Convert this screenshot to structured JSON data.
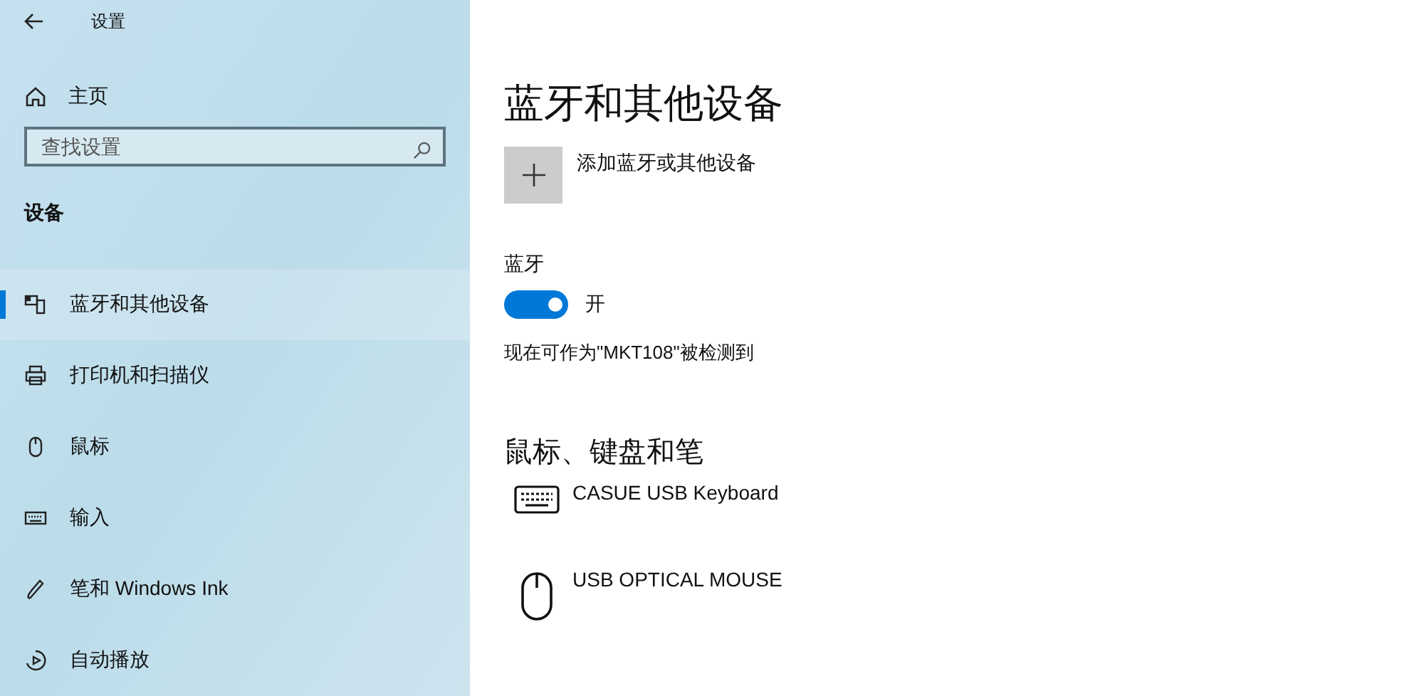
{
  "window": {
    "title": "设置"
  },
  "sidebar": {
    "home": "主页",
    "search": {
      "placeholder": "查找设置"
    },
    "section": "设备",
    "items": [
      {
        "label": "蓝牙和其他设备",
        "kind": "bluetooth",
        "selected": true
      },
      {
        "label": "打印机和扫描仪",
        "kind": "printer",
        "selected": false
      },
      {
        "label": "鼠标",
        "kind": "mouse",
        "selected": false
      },
      {
        "label": "输入",
        "kind": "keyboard",
        "selected": false
      },
      {
        "label": "笔和 Windows Ink",
        "kind": "pen",
        "selected": false
      },
      {
        "label": "自动播放",
        "kind": "autoplay",
        "selected": false
      }
    ]
  },
  "main": {
    "title": "蓝牙和其他设备",
    "add_device": "添加蓝牙或其他设备",
    "bluetooth": {
      "label": "蓝牙",
      "on": true,
      "state_text": "开"
    },
    "discoverable": "现在可作为\"MKT108\"被检测到",
    "section": "鼠标、键盘和笔",
    "devices": [
      {
        "name": "CASUE USB Keyboard",
        "kind": "keyboard"
      },
      {
        "name": "USB OPTICAL MOUSE",
        "kind": "mouse"
      }
    ]
  }
}
